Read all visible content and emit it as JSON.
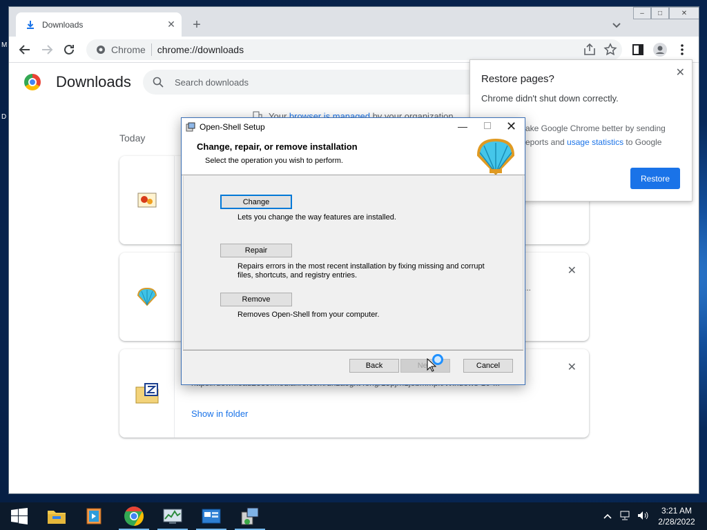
{
  "desktop": {
    "edge_label_1": "M",
    "edge_label_2": "D"
  },
  "chrome": {
    "tab": {
      "title": "Downloads"
    },
    "window_buttons": {
      "minimize": "–",
      "maximize": "□",
      "close": "✕"
    },
    "omnibox": {
      "chip": "Chrome",
      "url": "chrome://downloads"
    }
  },
  "downloads": {
    "title": "Downloads",
    "search_placeholder": "Search downloads",
    "managed_prefix": "Your ",
    "managed_link": "browser is managed",
    "managed_suffix": " by your organization",
    "section_today": "Today",
    "items": [
      {
        "icon": "image-file-icon"
      },
      {
        "icon": "open-shell-icon",
        "url_tail": "..."
      },
      {
        "icon": "zip-archive-icon",
        "url": "https://download2389.mediafire.com/dhzaogxt4ong/15pjrh1jobmmpk/Windows-10-...",
        "show_in_folder": "Show in folder"
      }
    ]
  },
  "restore_popup": {
    "title": "Restore pages?",
    "message": "Chrome didn't shut down correctly.",
    "help_text_1": "ake Google Chrome better by sending",
    "help_text_2": "eports and ",
    "help_link": "usage statistics",
    "help_text_3": " to Google",
    "restore_button": "Restore"
  },
  "setup_dialog": {
    "window_title": "Open-Shell Setup",
    "heading": "Change, repair, or remove installation",
    "subheading": "Select the operation you wish to perform.",
    "options": [
      {
        "label": "Change",
        "description": "Lets you change the way features are installed."
      },
      {
        "label": "Repair",
        "description": "Repairs errors in the most recent installation by fixing missing and corrupt files, shortcuts, and registry entries."
      },
      {
        "label": "Remove",
        "description": "Removes Open-Shell from your computer."
      }
    ],
    "back_button": "Back",
    "next_button": "Next",
    "cancel_button": "Cancel"
  },
  "taskbar": {
    "apps": [
      "file-explorer-icon",
      "media-player-icon",
      "chrome-icon",
      "task-manager-icon",
      "control-panel-icon",
      "installer-icon"
    ],
    "time": "3:21 AM",
    "date": "2/28/2022"
  },
  "colors": {
    "accent": "#1a73e8",
    "dialog_border": "#3b6fb5",
    "taskbar": "#0c1a2b"
  }
}
